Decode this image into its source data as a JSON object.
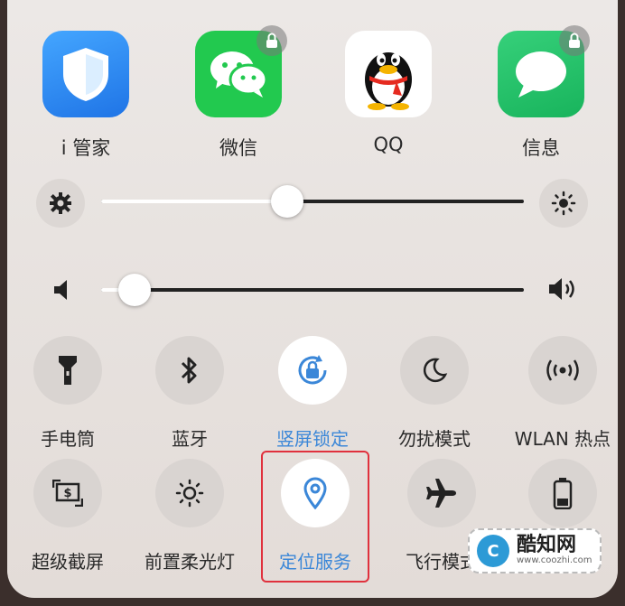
{
  "apps": [
    {
      "label": "i 管家",
      "icon": "shield-icon",
      "color": "#2d8ff0",
      "locked": false
    },
    {
      "label": "微信",
      "icon": "wechat-icon",
      "color": "#1fc74f",
      "locked": true
    },
    {
      "label": "QQ",
      "icon": "penguin-icon",
      "color": "#ffffff",
      "locked": false
    },
    {
      "label": "信息",
      "icon": "message-bubble-icon",
      "color": "#20c46a",
      "locked": true
    }
  ],
  "sliders": {
    "brightness": {
      "level": 0.44,
      "left_icon": "gear-icon",
      "right_icon": "sun-icon"
    },
    "volume": {
      "level": 0.08,
      "left_icon": "speaker-low-icon",
      "right_icon": "speaker-high-icon"
    }
  },
  "toggles_row1": [
    {
      "label": "手电筒",
      "icon": "flashlight-icon",
      "active": false
    },
    {
      "label": "蓝牙",
      "icon": "bluetooth-icon",
      "active": false
    },
    {
      "label": "竖屏锁定",
      "icon": "rotation-lock-icon",
      "active": true
    },
    {
      "label": "勿扰模式",
      "icon": "moon-icon",
      "active": false
    },
    {
      "label": "WLAN 热点",
      "icon": "hotspot-icon",
      "active": false
    }
  ],
  "toggles_row2": [
    {
      "label": "超级截屏",
      "icon": "screenshot-icon",
      "active": false
    },
    {
      "label": "前置柔光灯",
      "icon": "fill-light-icon",
      "active": false
    },
    {
      "label": "定位服务",
      "icon": "location-pin-icon",
      "active": true
    },
    {
      "label": "飞行模式",
      "icon": "airplane-icon",
      "active": false
    },
    {
      "label": "",
      "icon": "battery-icon",
      "active": false
    }
  ],
  "colors": {
    "active_accent": "#3b87d8",
    "highlight_border": "#e0313d"
  },
  "watermark": {
    "title": "酷知网",
    "url": "www.coozhi.com",
    "logo_text": "C"
  }
}
